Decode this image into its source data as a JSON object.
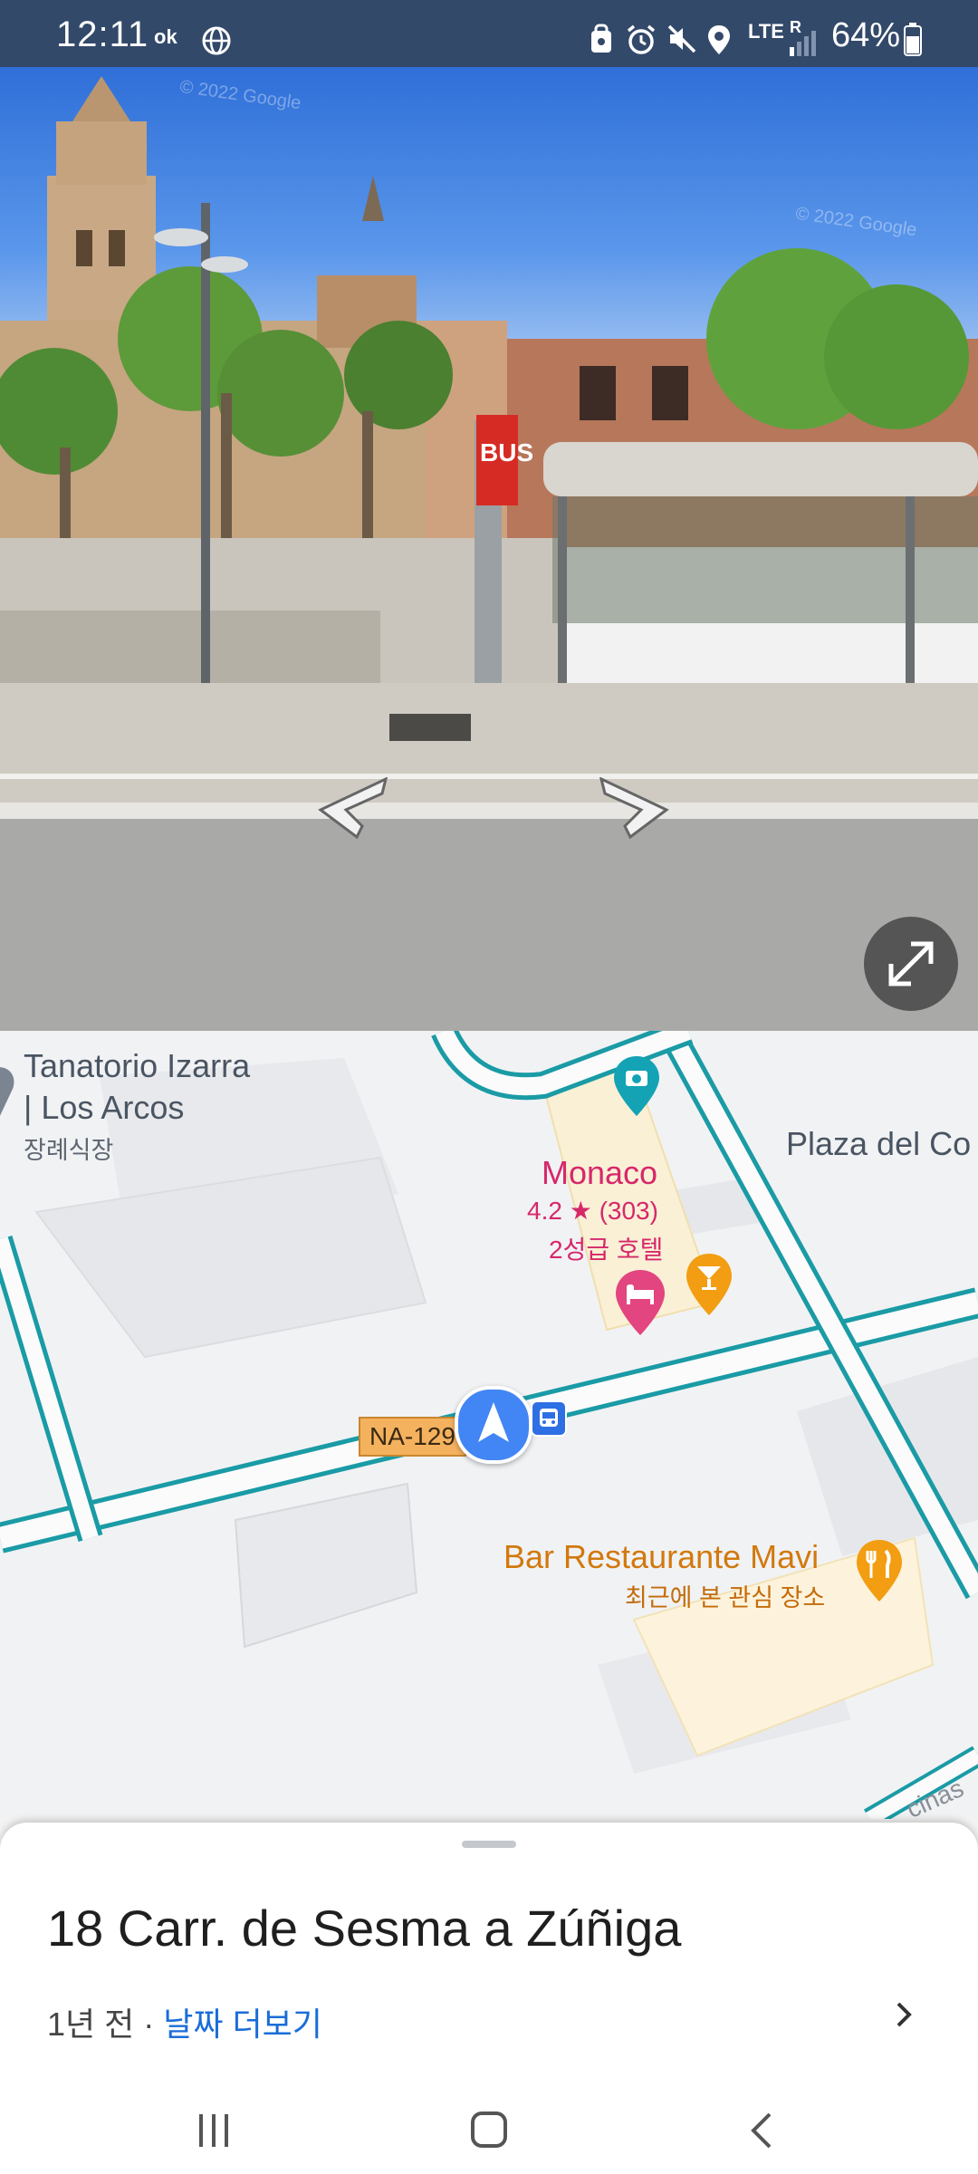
{
  "status_bar": {
    "time": "12:11",
    "carrier_badge": "ok",
    "network": "LTE",
    "network_r": "R",
    "battery": "64%",
    "icons": [
      "ok-icon",
      "globe-icon",
      "vpn-icon",
      "alarm-icon",
      "mute-icon",
      "location-icon",
      "signal-icon",
      "battery-icon"
    ]
  },
  "street_view": {
    "watermark_1": "© 2022 Google",
    "watermark_2": "© 2022 Google",
    "bus_sign": "BUS"
  },
  "map": {
    "place_1": {
      "name_line1": "Tanatorio Izarra",
      "name_line2": "| Los Arcos",
      "category": "장례식장"
    },
    "place_2": {
      "name": "Monaco",
      "rating": "4.2 ★ (303)",
      "category": "2성급 호텔"
    },
    "place_3": {
      "name": "Plaza del Co"
    },
    "place_4": {
      "name": "Bar Restaurante Mavi",
      "note": "최근에 본 관심 장소"
    },
    "road_shield": "NA-129",
    "street_corner": "cinas",
    "colors": {
      "road_outline": "#1a9ba5",
      "pin": "#4285f4",
      "hotel": "#d6286b",
      "restaurant": "#f29d12"
    }
  },
  "sheet": {
    "address": "18 Carr. de Sesma a Zúñiga",
    "date_prefix": "1년 전 · ",
    "date_link": "날짜 더보기"
  },
  "nav_bar": {
    "buttons": [
      "recent-apps-icon",
      "home-icon",
      "back-icon"
    ]
  }
}
